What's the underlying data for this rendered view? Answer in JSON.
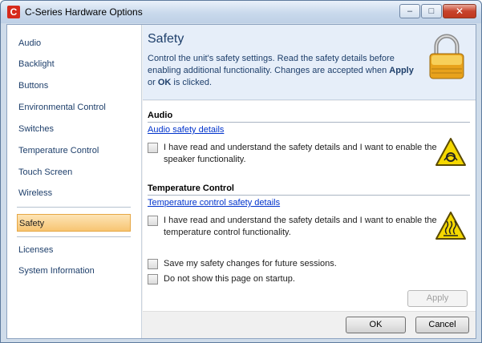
{
  "window": {
    "title": "C-Series Hardware Options",
    "app_icon_glyph": "C",
    "controls": {
      "minimize": "–",
      "maximize": "□",
      "close": "✕"
    }
  },
  "sidebar": {
    "items": [
      {
        "label": "Audio"
      },
      {
        "label": "Backlight"
      },
      {
        "label": "Buttons"
      },
      {
        "label": "Environmental Control"
      },
      {
        "label": "Switches"
      },
      {
        "label": "Temperature Control"
      },
      {
        "label": "Touch Screen"
      },
      {
        "label": "Wireless"
      },
      {
        "label": "Safety",
        "selected": true
      },
      {
        "label": "Licenses"
      },
      {
        "label": "System Information"
      }
    ]
  },
  "header": {
    "title": "Safety",
    "desc_part1": "Control the unit's safety settings. Read the safety details before enabling additional functionality. Changes are accepted when ",
    "desc_apply": "Apply",
    "desc_or": " or ",
    "desc_ok": "OK",
    "desc_end": " is clicked.",
    "icon": "padlock-icon"
  },
  "sections": {
    "audio": {
      "title": "Audio",
      "link": "Audio safety details",
      "checkbox_label": "I have read and understand the safety details and I want to enable the speaker functionality.",
      "checked": false,
      "icon": "speaker-warning-icon"
    },
    "temperature": {
      "title": "Temperature Control",
      "link": "Temperature control safety details",
      "checkbox_label": "I have read and understand the safety details and I want to enable the temperature control functionality.",
      "checked": false,
      "icon": "hot-surface-warning-icon"
    }
  },
  "options": {
    "save_label": "Save my safety changes for future sessions.",
    "save_checked": false,
    "hide_label": "Do not show this page on startup.",
    "hide_checked": false
  },
  "buttons": {
    "apply": "Apply",
    "ok": "OK",
    "cancel": "Cancel"
  },
  "colors": {
    "accent": "#1e3f6b",
    "selection": "#f7c572",
    "link": "#0033cc",
    "warning": "#f5d800"
  }
}
